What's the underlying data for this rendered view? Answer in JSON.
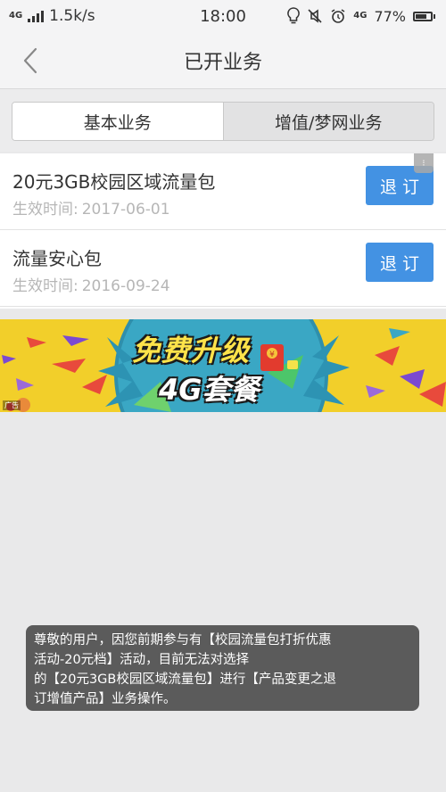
{
  "status_bar": {
    "network_type": "4G",
    "speed": "1.5k/s",
    "time": "18:00",
    "battery_network": "4G",
    "battery_percent": "77%",
    "battery_level": 0.77
  },
  "header": {
    "title": "已开业务"
  },
  "tabs": [
    {
      "label": "基本业务",
      "active": true
    },
    {
      "label": "增值/梦网业务",
      "active": false
    }
  ],
  "services": [
    {
      "name": "20元3GB校园区域流量包",
      "date_label": "生效时间:",
      "date": "2017-06-01",
      "action": "退订"
    },
    {
      "name": "流量安心包",
      "date_label": "生效时间:",
      "date": "2016-09-24",
      "action": "退订"
    }
  ],
  "banner": {
    "line1": "免费升级",
    "line2": "4G套餐",
    "ad_tag": "广告",
    "colors": {
      "background": "#f2cf2a",
      "circle": "#3aa7c4"
    }
  },
  "toast": {
    "lines": [
      "尊敬的用户，因您前期参与有【校园流量包打折优惠",
      "活动-20元档】活动，目前无法对选择",
      "的【20元3GB校园区域流量包】进行【产品变更之退",
      "订增值产品】业务操作。"
    ]
  },
  "colors": {
    "accent": "#4392e3",
    "page_bg": "#e9e9ea",
    "toast_bg": "#5b5b5b"
  }
}
